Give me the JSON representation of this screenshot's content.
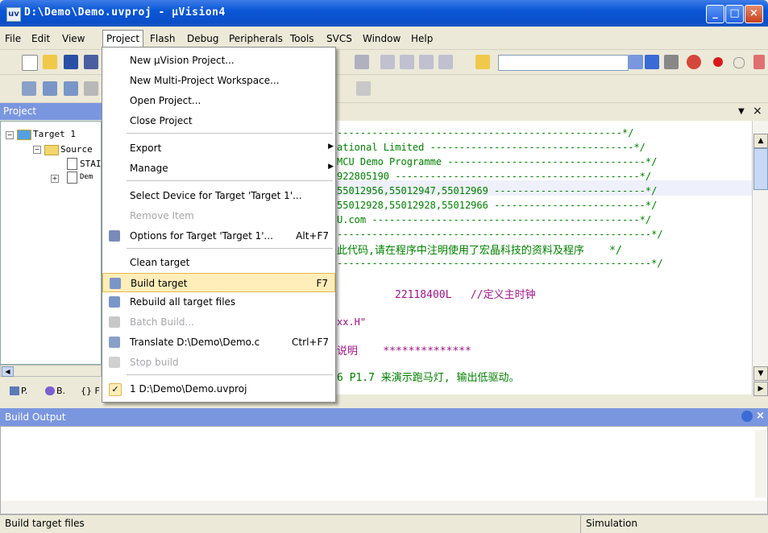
{
  "window": {
    "title": "D:\\Demo\\Demo.uvproj - µVision4",
    "app_icon": "uv",
    "buttons": {
      "minimize": "_",
      "maximize": "□",
      "close": "×"
    }
  },
  "menubar": [
    "File",
    "Edit",
    "View",
    "Project",
    "Flash",
    "Debug",
    "Peripherals",
    "Tools",
    "SVCS",
    "Window",
    "Help"
  ],
  "project_panel": {
    "title": "Project",
    "tree": [
      "Target 1",
      "Source",
      "STAI",
      "Dem"
    ],
    "tabs": [
      "P.",
      "B.",
      "{} F"
    ]
  },
  "editor": {
    "close": "×",
    "lines": [
      "-------------------------------------------------*/",
      "ational Limited -----------------------------------*/",
      "MCU Demo Programme ----------------------------------*/",
      "922805190 ------------------------------------------*/",
      "55012956,55012947,55012969 --------------------------*/",
      "55012928,55012928,55012966 --------------------------*/",
      "U.com ----------------------------------------------*/",
      "------------------------------------------------------*/",
      "此代码,请在程序中注明使用了宏晶科技的资料及程序    */",
      "------------------------------------------------------*/",
      "22118400L   //定义主时钟",
      "xx.H\"",
      "说明    **************",
      "6 P1.7 来演示跑马灯, 输出低驱动。"
    ]
  },
  "build_output": {
    "title": "Build Output"
  },
  "status": {
    "left": "Build target files",
    "mode": "Simulation"
  },
  "project_menu": {
    "items": [
      {
        "label": "New µVision Project...",
        "shortcut": ""
      },
      {
        "label": "New Multi-Project Workspace...",
        "shortcut": ""
      },
      {
        "label": "Open Project...",
        "shortcut": ""
      },
      {
        "label": "Close Project",
        "shortcut": ""
      },
      {
        "label": "Export",
        "shortcut": ""
      },
      {
        "label": "Manage",
        "shortcut": ""
      },
      {
        "label": "Select Device for Target 'Target 1'...",
        "shortcut": ""
      },
      {
        "label": "Remove Item",
        "shortcut": ""
      },
      {
        "label": "Options for Target 'Target 1'...",
        "shortcut": "Alt+F7"
      },
      {
        "label": "Clean target",
        "shortcut": ""
      },
      {
        "label": "Build target",
        "shortcut": "F7"
      },
      {
        "label": "Rebuild all target files",
        "shortcut": ""
      },
      {
        "label": "Batch Build...",
        "shortcut": ""
      },
      {
        "label": "Translate D:\\Demo\\Demo.c",
        "shortcut": "Ctrl+F7"
      },
      {
        "label": "Stop build",
        "shortcut": ""
      },
      {
        "label": "1 D:\\Demo\\Demo.uvproj",
        "shortcut": ""
      }
    ]
  },
  "colors": {
    "accent": "#0a57d6",
    "panel_header": "#7a96df",
    "highlight": "#ffeeb9",
    "code": "#008000"
  }
}
